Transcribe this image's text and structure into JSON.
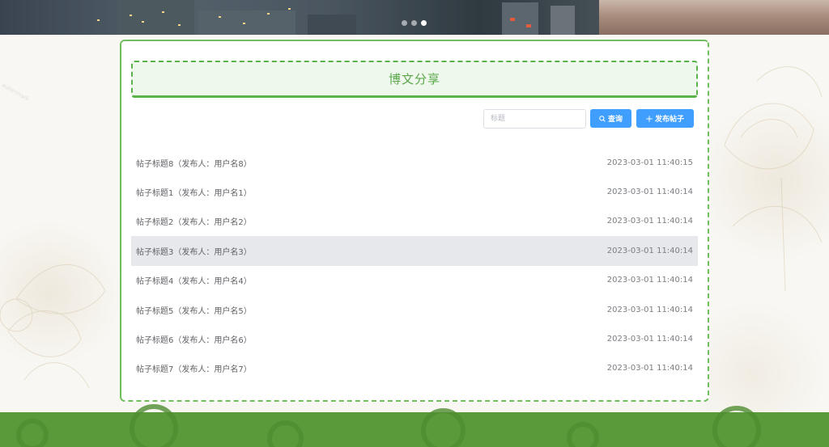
{
  "banner": {
    "slide_count": 3,
    "active_slide": 3
  },
  "page": {
    "title": "博文分享"
  },
  "search": {
    "placeholder": "标题",
    "value": "",
    "search_label": "查询",
    "post_label": "发布帖子"
  },
  "posts": [
    {
      "title": "帖子标题8（发布人：用户名8）",
      "time": "2023-03-01 11:40:15"
    },
    {
      "title": "帖子标题1（发布人：用户名1）",
      "time": "2023-03-01 11:40:14"
    },
    {
      "title": "帖子标题2（发布人：用户名2）",
      "time": "2023-03-01 11:40:14"
    },
    {
      "title": "帖子标题3（发布人：用户名3）",
      "time": "2023-03-01 11:40:14"
    },
    {
      "title": "帖子标题4（发布人：用户名4）",
      "time": "2023-03-01 11:40:14"
    },
    {
      "title": "帖子标题5（发布人：用户名5）",
      "time": "2023-03-01 11:40:14"
    },
    {
      "title": "帖子标题6（发布人：用户名6）",
      "time": "2023-03-01 11:40:14"
    },
    {
      "title": "帖子标题7（发布人：用户名7）",
      "time": "2023-03-01 11:40:14"
    }
  ],
  "highlighted_index": 3,
  "colors": {
    "accent": "#409eff",
    "brand_green": "#5bb24a",
    "title_bg": "#eef8ec",
    "footer": "#5b9a3a"
  }
}
